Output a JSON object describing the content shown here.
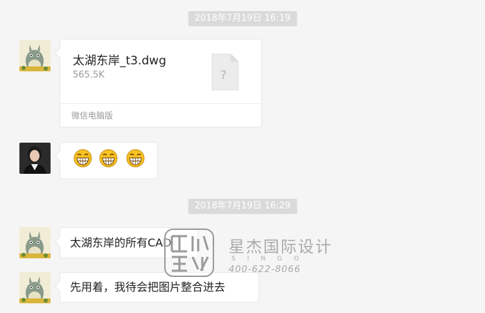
{
  "chat": {
    "timestamp_1": "2018年7月19日 16:19",
    "file_message": {
      "name": "太湖东岸_t3.dwg",
      "size": "565.5K",
      "source": "微信电脑版",
      "file_type_glyph": "?"
    },
    "emoji_message": {
      "emoji": [
        "grinning-face",
        "grinning-face",
        "grinning-face"
      ]
    },
    "timestamp_2": "2018年7月19日 16:29",
    "text_message_1": "太湖东岸的所有CAD",
    "text_message_2": "先用着，我待会把图片整合进去"
  },
  "watermark": {
    "chinese": "星杰国际设计",
    "english": "SINGO",
    "phone": "400-622-8066"
  }
}
